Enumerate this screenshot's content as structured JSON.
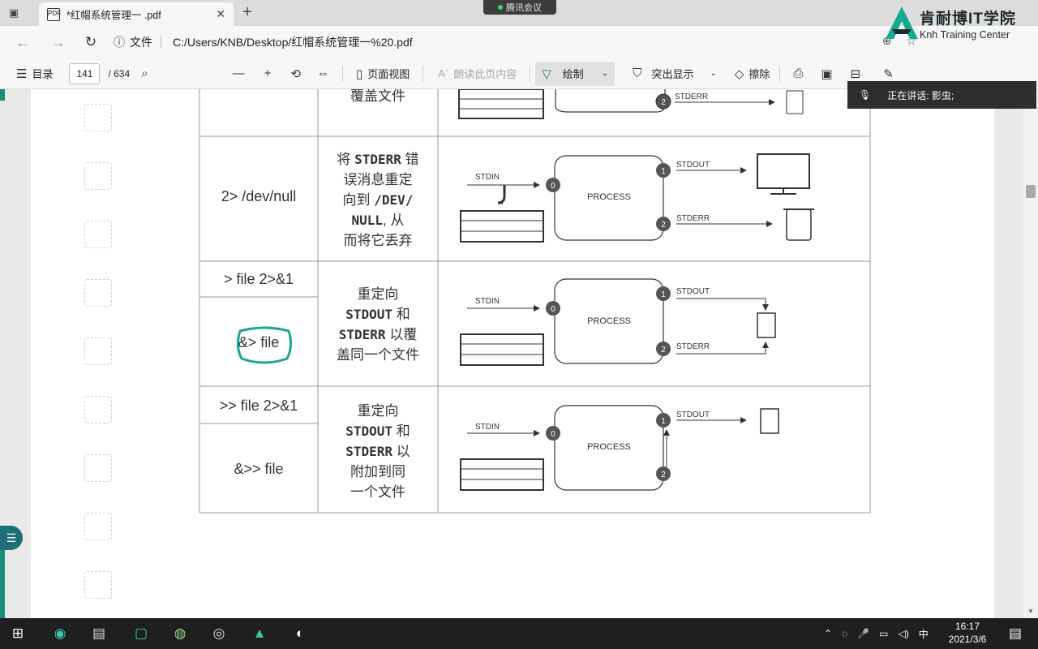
{
  "browser": {
    "window_icon": "window-icon",
    "tab_title": "*红帽系统管理一 .pdf",
    "tab_close": "✕",
    "new_tab": "+",
    "address_scheme": "文件",
    "address_url": "C:/Users/KNB/Desktop/红帽系统管理一%20.pdf"
  },
  "meeting_indicator": "腾讯会议",
  "logo": {
    "cn": "肯耐博IT学院",
    "en": "Knh Training Center"
  },
  "pdf_toolbar": {
    "toc_label": "目录",
    "page_current": "141",
    "page_total": "/ 634",
    "page_view_label": "页面视图",
    "read_aloud_label": "朗读此页内容",
    "draw_label": "绘制",
    "highlight_label": "突出显示",
    "erase_label": "擦除"
  },
  "speaker_banner": {
    "label": "正在讲话: 影虫;"
  },
  "table": {
    "rows": [
      {
        "cmd": [
          "",
          ""
        ],
        "desc": [
          "覆盖文件"
        ],
        "diagram": "partial"
      },
      {
        "cmd": [
          "2> /dev/null"
        ],
        "desc_parts": [
          [
            "将 ",
            "STDERR",
            " 错"
          ],
          [
            "误消息重定"
          ],
          [
            "向到 ",
            "/DEV/"
          ],
          [
            "NULL",
            ", 从"
          ],
          [
            "而将它丢弃"
          ]
        ]
      },
      {
        "cmd": [
          "> file  2>&1",
          "&> file"
        ],
        "desc_parts": [
          [
            "重定向"
          ],
          [
            "STDOUT",
            " 和"
          ],
          [
            "STDERR",
            " 以覆"
          ],
          [
            "盖同一个文件"
          ]
        ]
      },
      {
        "cmd": [
          ">> file  2>&1",
          "&>> file"
        ],
        "desc_parts": [
          [
            "重定向"
          ],
          [
            "STDOUT",
            " 和"
          ],
          [
            "STDERR",
            " 以"
          ],
          [
            "附加到同"
          ],
          [
            "一个文件"
          ]
        ]
      }
    ],
    "diagram_labels": {
      "stdin": "STDIN",
      "stdout": "STDOUT",
      "stderr": "STDERR",
      "process": "PROCESS",
      "fd0": "0",
      "fd1": "1",
      "fd2": "2"
    }
  },
  "taskbar": {
    "apps": [
      "windows-start-icon",
      "edge-icon",
      "file-explorer-icon",
      "meeting-app-icon",
      "photoshop-icon",
      "obs-icon",
      "conference-icon",
      "chrome-icon"
    ],
    "ime": "中",
    "time": "16:17",
    "date": "2021/3/6"
  }
}
